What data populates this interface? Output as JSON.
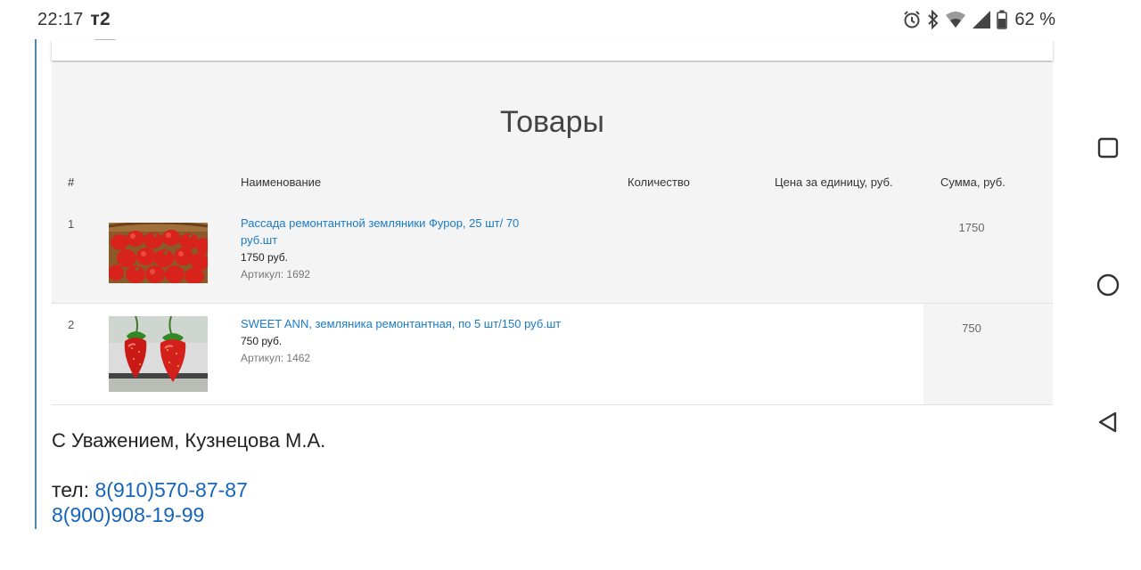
{
  "status_bar": {
    "time": "22:17",
    "carrier_glyph": "т2",
    "battery_percent": "62 %",
    "icons": [
      "alarm-icon",
      "bluetooth-icon",
      "wifi-icon",
      "cell-signal-icon",
      "battery-icon"
    ]
  },
  "products": {
    "title": "Товары",
    "columns": {
      "num": "#",
      "name": "Наименование",
      "qty": "Количество",
      "unit_price": "Цена за единицу, руб.",
      "sum": "Сумма, руб."
    },
    "rows": [
      {
        "num": "1",
        "name": "Рассада ремонтантной земляники Фурор, 25 шт/ 70 руб.шт",
        "price": "1750 руб.",
        "sku": "Артикул: 1692",
        "sum": "1750"
      },
      {
        "num": "2",
        "name": "SWEET ANN, земляника ремонтантная, по 5 шт/150 руб.шт",
        "price": "750 руб.",
        "sku": "Артикул: 1462",
        "sum": "750"
      }
    ]
  },
  "signature": "С Уважением, Кузнецова М.А.",
  "contacts": {
    "phone_label": "тел: ",
    "phone1": "8(910)570-87-87",
    "phone2": "8(900)908-19-99"
  },
  "colors": {
    "link": "#1a7bc9",
    "phone_link": "#1665b8",
    "quote_rule": "#4a86c8",
    "table_bg": "#f4f4f4"
  },
  "nav_bar": [
    "square-recents-icon",
    "circle-home-icon",
    "triangle-back-icon"
  ]
}
